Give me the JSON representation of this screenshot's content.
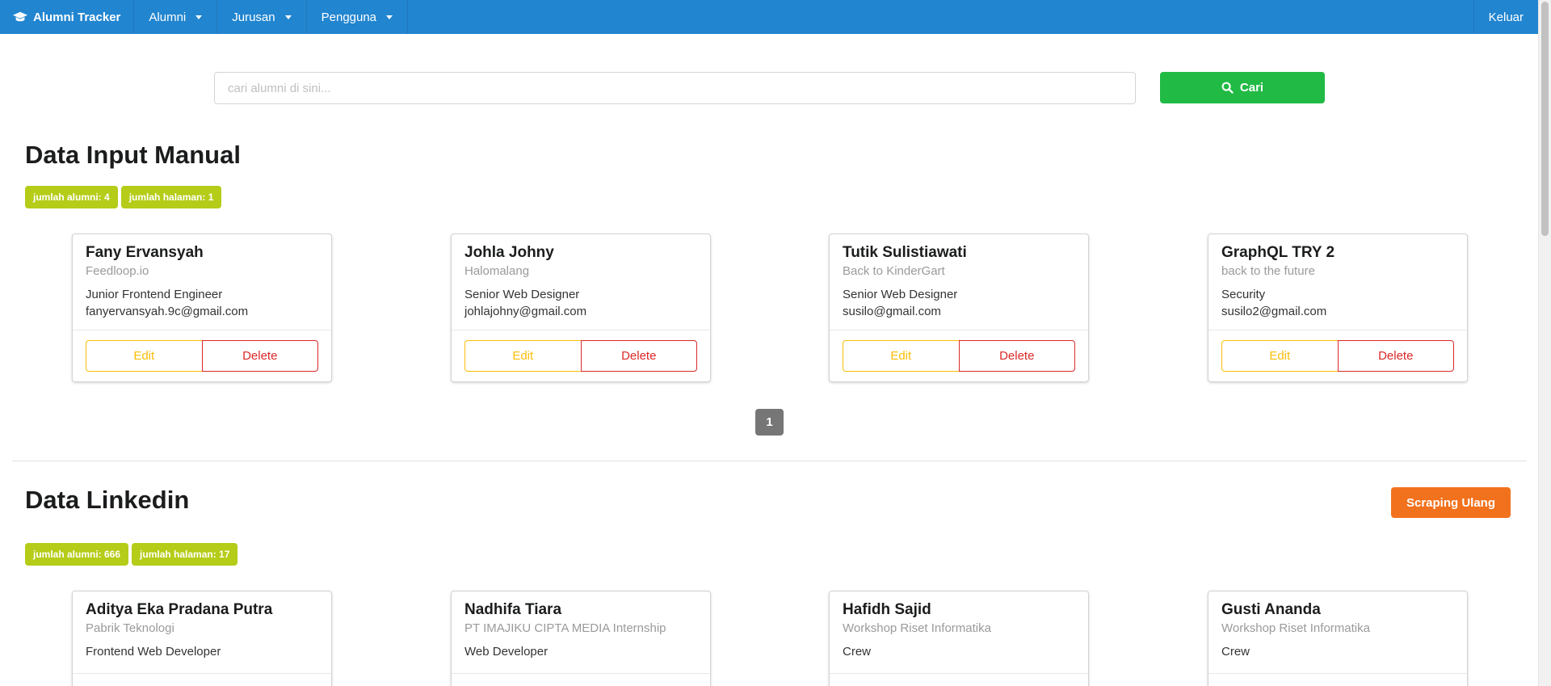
{
  "navbar": {
    "brand": "Alumni Tracker",
    "menus": [
      {
        "label": "Alumni"
      },
      {
        "label": "Jurusan"
      },
      {
        "label": "Pengguna"
      }
    ],
    "logout": "Keluar",
    "color": "#2185d0"
  },
  "search": {
    "placeholder": "cari alumni di sini...",
    "value": "",
    "button_label": "Cari"
  },
  "manual": {
    "title": "Data Input Manual",
    "badges": [
      "jumlah alumni: 4",
      "jumlah halaman: 1"
    ],
    "cards": [
      {
        "name": "Fany Ervansyah",
        "company": "Feedloop.io",
        "position": "Junior Frontend Engineer",
        "email": "fanyervansyah.9c@gmail.com",
        "edit": "Edit",
        "delete": "Delete"
      },
      {
        "name": "Johla Johny",
        "company": "Halomalang",
        "position": "Senior Web Designer",
        "email": "johlajohny@gmail.com",
        "edit": "Edit",
        "delete": "Delete"
      },
      {
        "name": "Tutik Sulistiawati",
        "company": "Back to KinderGart",
        "position": "Senior Web Designer",
        "email": "susilo@gmail.com",
        "edit": "Edit",
        "delete": "Delete"
      },
      {
        "name": "GraphQL TRY 2",
        "company": "back to the future",
        "position": "Security",
        "email": "susilo2@gmail.com",
        "edit": "Edit",
        "delete": "Delete"
      }
    ],
    "page": "1"
  },
  "linkedin": {
    "title": "Data Linkedin",
    "scrape_button": "Scraping Ulang",
    "badges": [
      "jumlah alumni: 666",
      "jumlah halaman: 17"
    ],
    "cards": [
      {
        "name": "Aditya Eka Pradana Putra",
        "company": "Pabrik Teknologi",
        "position": "Frontend Web Developer"
      },
      {
        "name": "Nadhifa Tiara",
        "company": "PT IMAJIKU CIPTA MEDIA Internship",
        "position": "Web Developer"
      },
      {
        "name": "Hafidh Sajid",
        "company": "Workshop Riset Informatika",
        "position": "Crew"
      },
      {
        "name": "Gusti Ananda",
        "company": "Workshop Riset Informatika",
        "position": "Crew"
      }
    ]
  },
  "colors": {
    "search_button": "#21ba45",
    "badge": "#b5cc18",
    "edit": "#fbbd08",
    "delete": "#db2828",
    "scrape": "#f2711c",
    "pagination_active": "#767676"
  },
  "icons": [
    "graduation-cap-icon",
    "chevron-down-icon",
    "search-icon"
  ]
}
